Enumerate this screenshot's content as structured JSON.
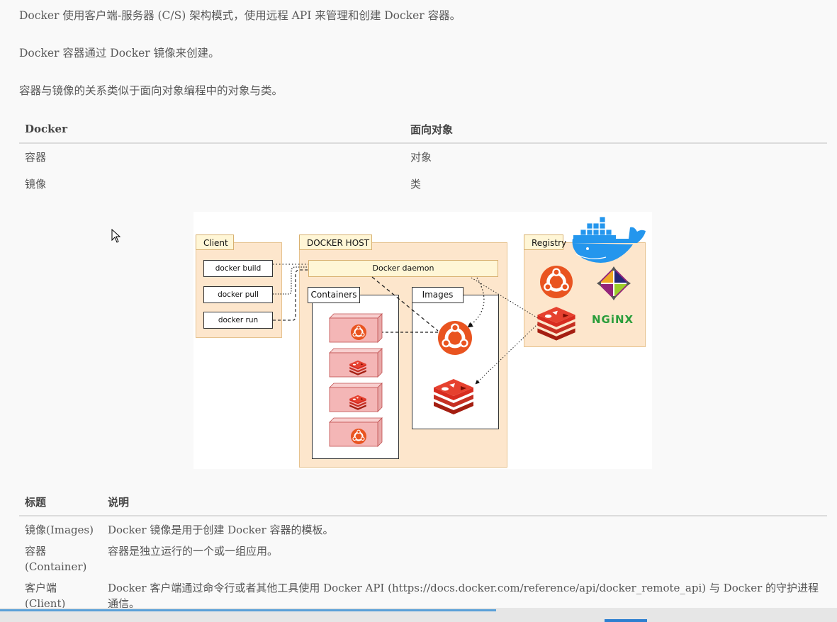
{
  "paragraphs": [
    "Docker 使用客户端-服务器 (C/S) 架构模式，使用远程 API 来管理和创建 Docker 容器。",
    "Docker 容器通过 Docker 镜像来创建。",
    "容器与镜像的关系类似于面向对象编程中的对象与类。"
  ],
  "table1": {
    "headers": [
      "Docker",
      "面向对象"
    ],
    "rows": [
      [
        "容器",
        "对象"
      ],
      [
        "镜像",
        "类"
      ]
    ]
  },
  "diagram": {
    "client": {
      "title": "Client",
      "commands": [
        "docker build",
        "docker pull",
        "docker run"
      ]
    },
    "host": {
      "title": "DOCKER HOST",
      "daemon": "Docker daemon",
      "containers": "Containers",
      "images": "Images"
    },
    "registry": {
      "title": "Registry",
      "nginx": "NGiNX"
    },
    "colors": {
      "ubuntu": "#e95420",
      "redis": "#d82c20",
      "host_fill": "#fde6cc",
      "docker_blue": "#2496ed"
    }
  },
  "table2": {
    "headers": [
      "标题",
      "说明"
    ],
    "rows": [
      [
        "镜像(Images)",
        "Docker 镜像是用于创建 Docker 容器的模板。"
      ],
      [
        "容器(Container)",
        "容器是独立运行的一个或一组应用。"
      ],
      [
        "客户端(Client)",
        "Docker 客户端通过命令行或者其他工具使用 Docker API (https://docs.docker.com/reference/api/docker_remote_api) 与 Docker 的守护进程通信。"
      ]
    ]
  }
}
